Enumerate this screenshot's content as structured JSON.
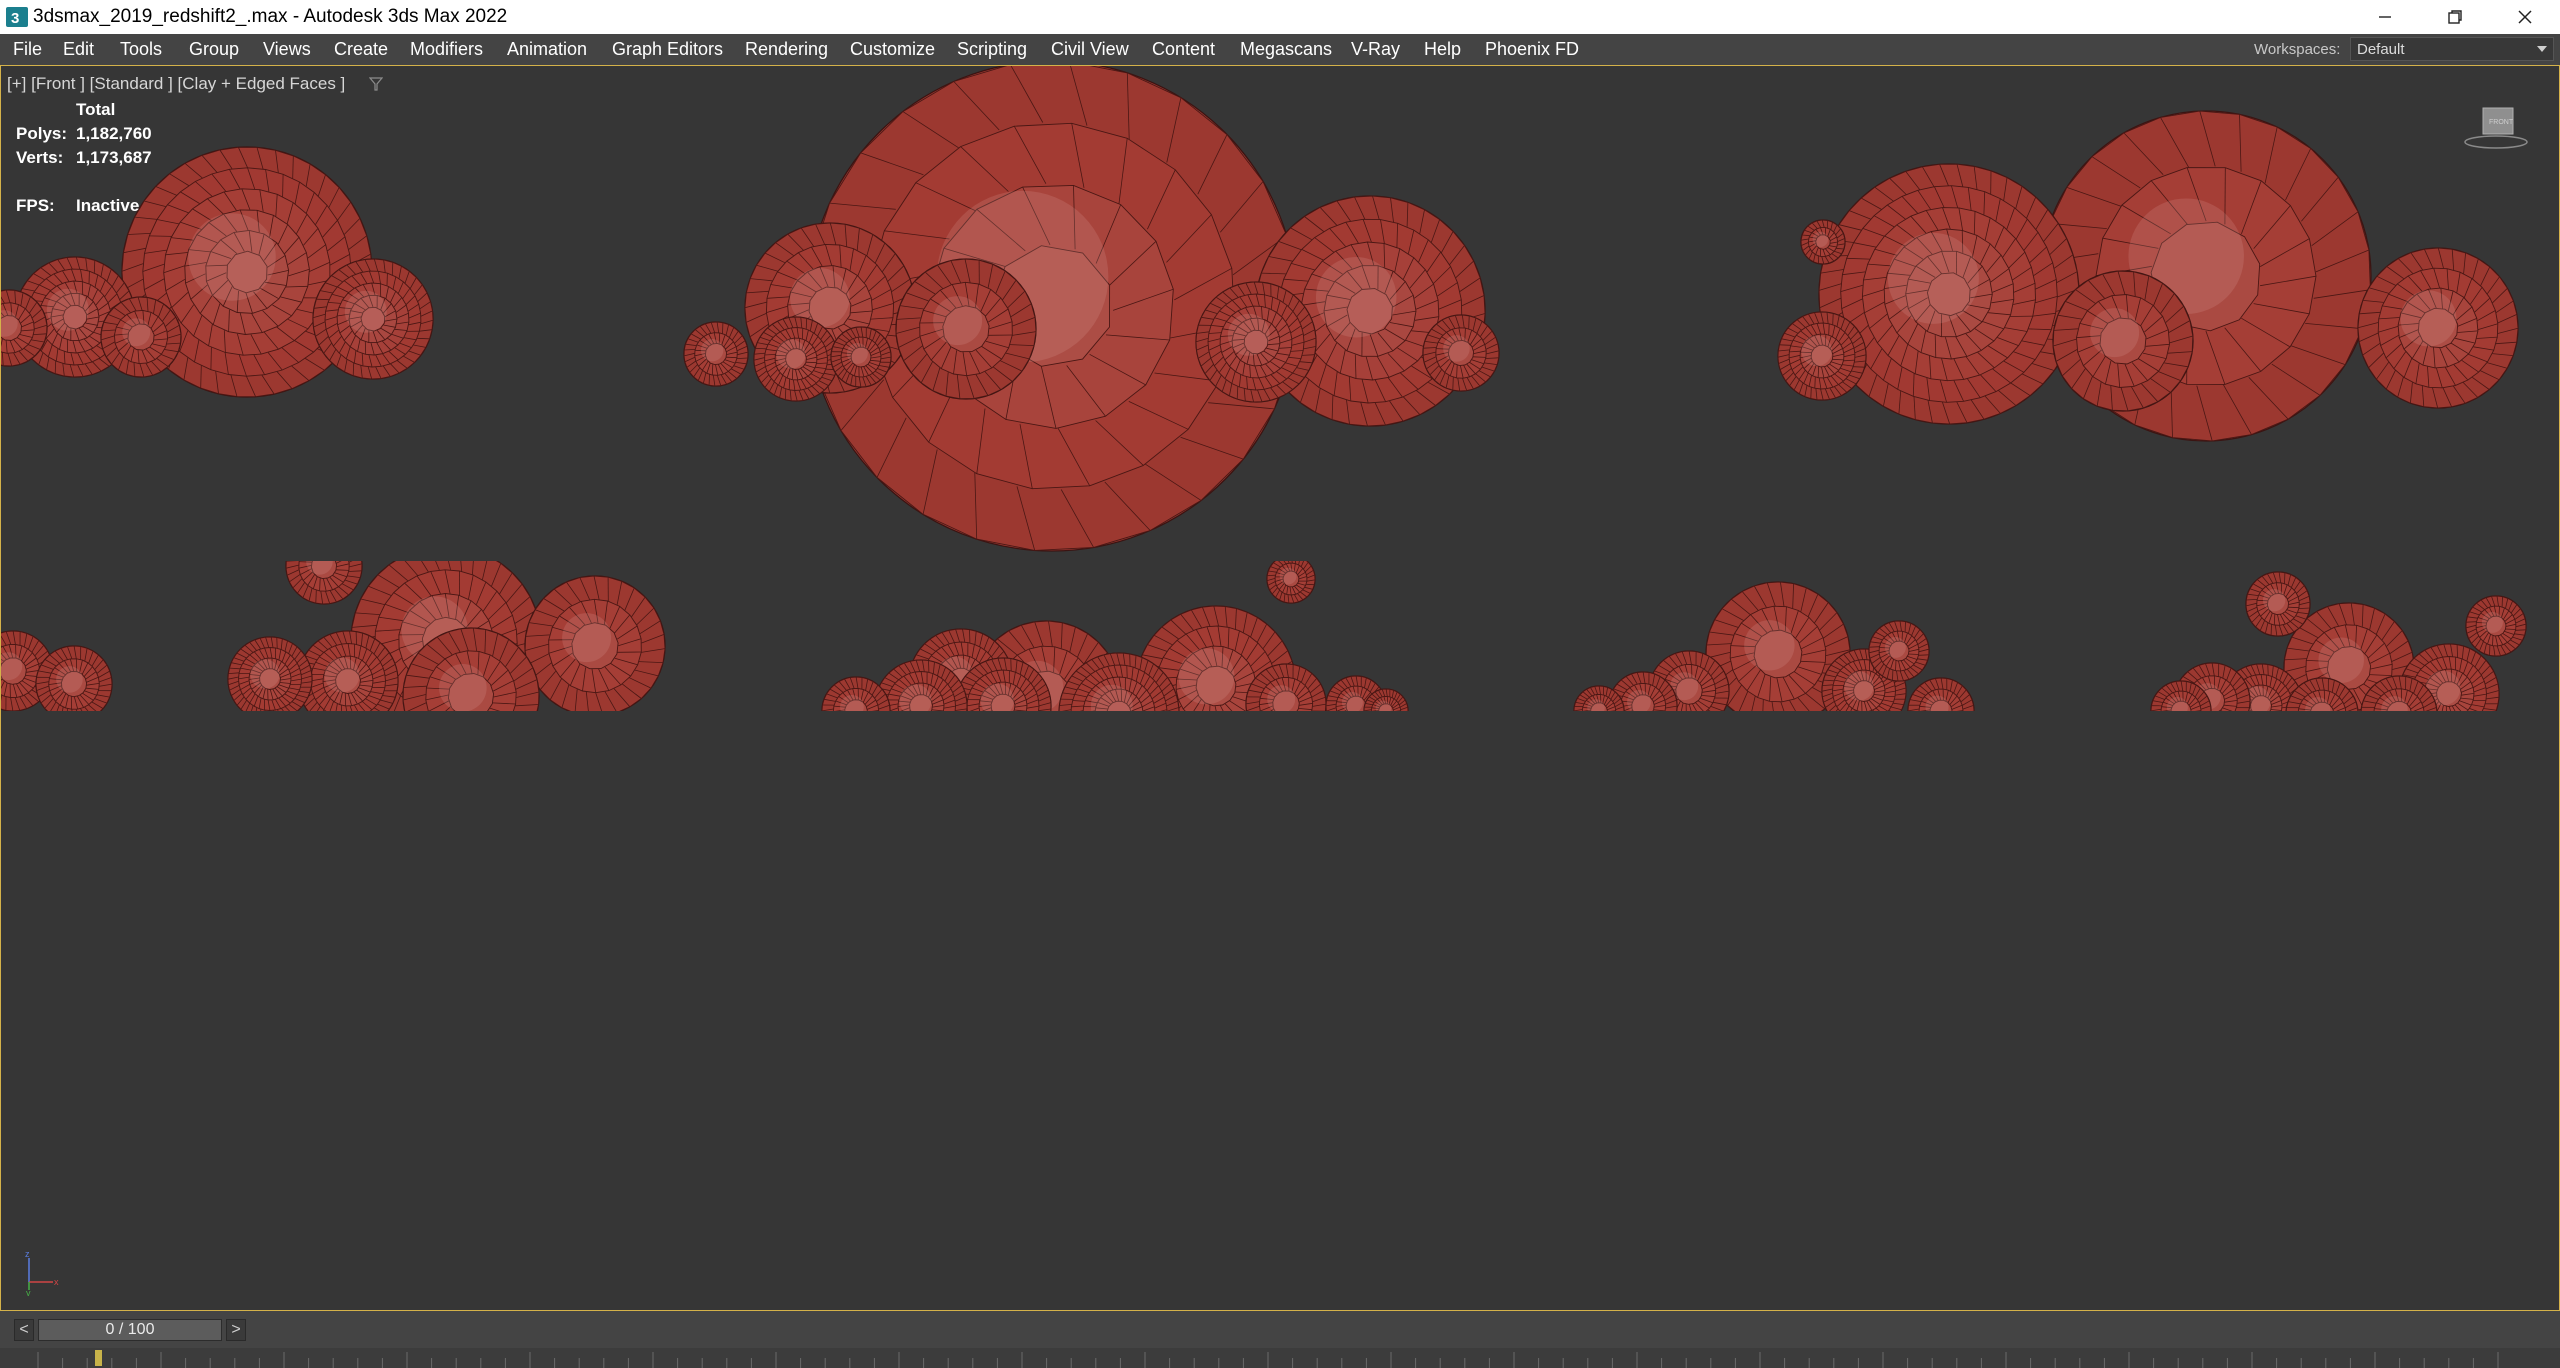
{
  "window": {
    "title": "3dsmax_2019_redshift2_.max - Autodesk 3ds Max 2022"
  },
  "menu": [
    "File",
    "Edit",
    "Tools",
    "Group",
    "Views",
    "Create",
    "Modifiers",
    "Animation",
    "Graph Editors",
    "Rendering",
    "Customize",
    "Scripting",
    "Civil View",
    "Content",
    "Megascans",
    "V-Ray",
    "Help",
    "Phoenix FD"
  ],
  "workspaces": {
    "label": "Workspaces:",
    "value": "Default"
  },
  "viewport": {
    "label": "[+] [Front ] [Standard ] [Clay + Edged Faces ]",
    "stats": {
      "header": "Total",
      "polys_label": "Polys:",
      "polys_value": "1,182,760",
      "verts_label": "Verts:",
      "verts_value": "1,173,687",
      "fps_label": "FPS:",
      "fps_value": "Inactive"
    },
    "viewcube_icon": "viewcube-icon",
    "axis_icon": "axis-tripod-icon",
    "accent_border": "#d4b24a",
    "background": "#363636",
    "mesh_color": "#a33a32"
  },
  "timeline": {
    "prev_label": "<",
    "next_label": ">",
    "slider_text": "0 / 100"
  }
}
